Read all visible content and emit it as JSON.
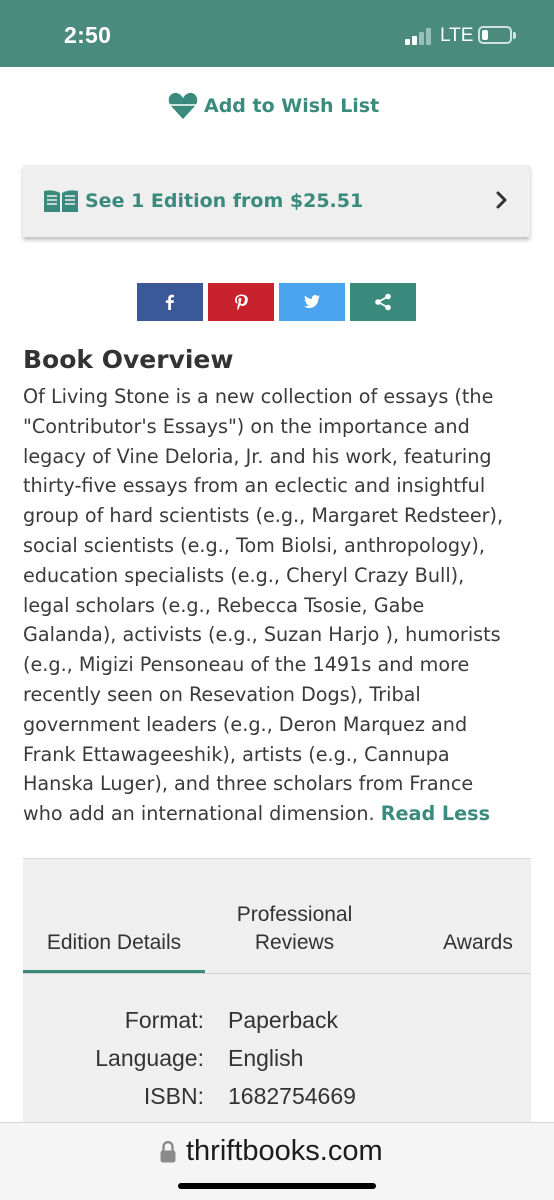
{
  "status_bar": {
    "time": "2:50",
    "network": "LTE"
  },
  "wishlist": {
    "label": "Add to Wish List",
    "icon": "heart-icon"
  },
  "editions": {
    "label": "See 1 Edition from $25.51",
    "icon": "open-book-icon"
  },
  "share_buttons": [
    {
      "name": "facebook",
      "icon": "facebook-icon",
      "color": "#3b5998"
    },
    {
      "name": "pinterest",
      "icon": "pinterest-icon",
      "color": "#c8232c"
    },
    {
      "name": "twitter",
      "icon": "twitter-icon",
      "color": "#4aa3ec"
    },
    {
      "name": "share",
      "icon": "share-icon",
      "color": "#3a8a7d"
    }
  ],
  "overview": {
    "title": "Book Overview",
    "lines": [
      "Of Living Stone is a new collection of essays (the",
      "\"Contributor's Essays\") on the importance and",
      "legacy of Vine Deloria, Jr. and his work, featuring",
      "thirty-five essays from an eclectic and insightful",
      "group of hard scientists (e.g., Margaret Redsteer),",
      "social scientists (e.g., Tom Biolsi, anthropology),",
      "education specialists (e.g., Cheryl Crazy Bull),",
      "legal scholars (e.g., Rebecca Tsosie, Gabe",
      "Galanda), activists (e.g., Suzan Harjo ), humorists",
      "(e.g., Migizi Pensoneau of the 1491s and more",
      "recently seen on Resevation Dogs), Tribal",
      "government leaders (e.g., Deron Marquez and",
      "Frank Ettawageeshik), artists (e.g., Cannupa",
      "Hanska Luger), and three scholars from France",
      "who add an international dimension. "
    ],
    "read_less": "Read Less"
  },
  "details": {
    "tabs": [
      "Edition Details",
      "Professional",
      "Reviews",
      "Awards"
    ],
    "specs": [
      {
        "key": "Format:",
        "value": "Paperback"
      },
      {
        "key": "Language:",
        "value": "English"
      },
      {
        "key": "ISBN:",
        "value": "1682754669"
      }
    ]
  },
  "browser": {
    "url": "thriftbooks.com"
  },
  "colors": {
    "accent": "#3a8a7d",
    "status_bar": "#4a8b7e"
  }
}
